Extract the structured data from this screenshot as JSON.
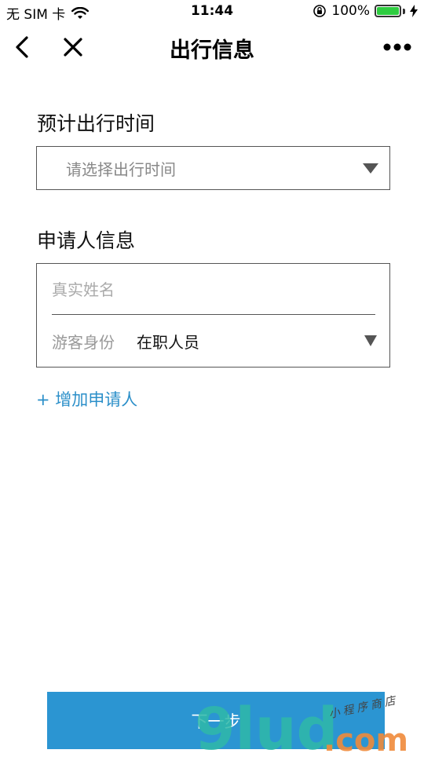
{
  "status_bar": {
    "carrier": "无 SIM 卡",
    "time": "11:44",
    "battery": "100%",
    "battery_level": 1.0
  },
  "nav": {
    "title": "出行信息",
    "icons": {
      "back": "chevron-left-icon",
      "close": "close-icon",
      "more": "more-dots-icon"
    }
  },
  "travel_time": {
    "label": "预计出行时间",
    "placeholder": "请选择出行时间"
  },
  "applicant": {
    "label": "申请人信息",
    "name_placeholder": "真实姓名",
    "identity_label": "游客身份",
    "identity_value": "在职人员"
  },
  "add_applicant": "+ 增加申请人",
  "next_button": "下一步",
  "watermark": {
    "brand": "9lud.com",
    "script": "小程序商店"
  },
  "colors": {
    "accent": "#2b8fc9",
    "button_bg": "#2b95d2",
    "battery_green": "#2ecc40",
    "border": "#555555"
  }
}
